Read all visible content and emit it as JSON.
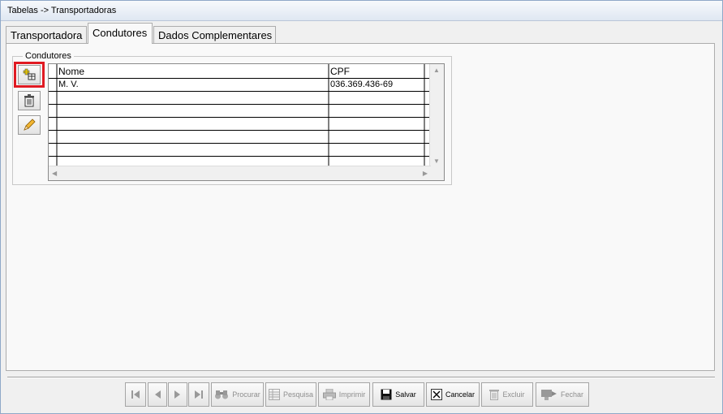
{
  "window": {
    "title": "Tabelas -> Transportadoras"
  },
  "tabs": [
    {
      "label": "Transportadora",
      "active": false
    },
    {
      "label": "Condutores",
      "active": true
    },
    {
      "label": "Dados Complementares",
      "active": false
    }
  ],
  "condutores": {
    "group_label": "Condutores",
    "columns": [
      "Nome",
      "CPF"
    ],
    "rows": [
      {
        "nome": "M. V.",
        "cpf": "036.369.436-69"
      }
    ],
    "side_buttons": [
      {
        "icon": "add-record-icon"
      },
      {
        "icon": "trash-icon"
      },
      {
        "icon": "pencil-icon"
      }
    ]
  },
  "toolbar": {
    "procurar": "Procurar",
    "pesquisa": "Pesquisa",
    "imprimir": "Imprimir",
    "salvar": "Salvar",
    "cancelar": "Cancelar",
    "excluir": "Excluir",
    "fechar": "Fechar"
  },
  "colors": {
    "highlight": "#e01a22",
    "disabled_text": "#8e8e8e"
  }
}
